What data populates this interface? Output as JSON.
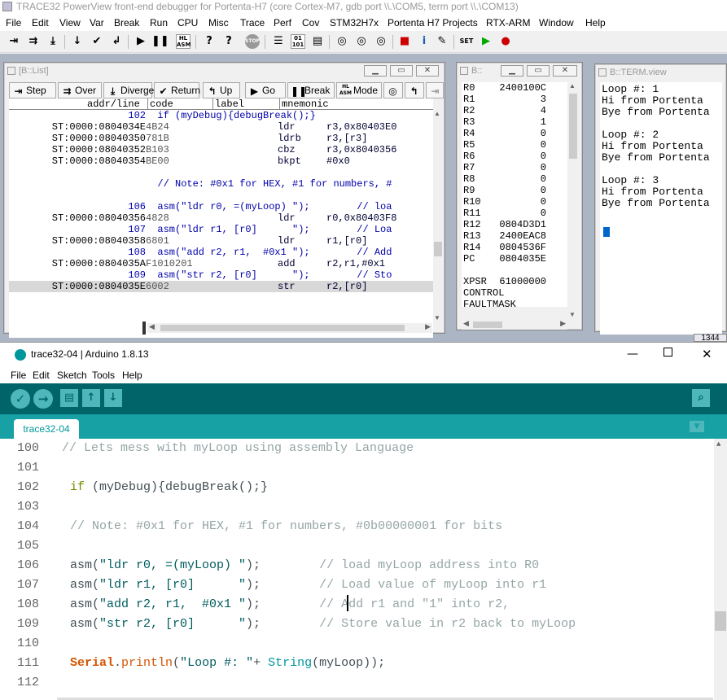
{
  "trace32": {
    "title": "TRACE32 PowerView front-end debugger for Portenta-H7 (core Cortex-M7, gdb port \\\\.\\COM5, term port \\\\.\\COM13)",
    "menu": [
      "File",
      "Edit",
      "View",
      "Var",
      "Break",
      "Run",
      "CPU",
      "Misc",
      "Trace",
      "Perf",
      "Cov",
      "STM32H7x",
      "Portenta H7 Projects",
      "RTX-ARM",
      "Window",
      "Help"
    ],
    "toolbar_icons": [
      "step-into-icon",
      "step-over-icon",
      "step-diverge-icon",
      "down-arrow-icon",
      "check-icon",
      "return-icon",
      "go-icon",
      "break-icon",
      "mode-icon",
      "help-icon",
      "context-help-icon",
      "stop-icon",
      "list-icon",
      "memory-icon",
      "registers-icon",
      "breakpoints-icon",
      "watch-icon",
      "var-icon",
      "cube-icon",
      "info-icon",
      "tools-icon",
      "set-icon",
      "go-green-icon",
      "stop-red-icon"
    ],
    "list_window": {
      "title": "[B::List]",
      "buttons": {
        "step": "Step",
        "over": "Over",
        "diverge": "Diverge",
        "return": "Return",
        "up": "Up",
        "go": "Go",
        "break": "Break",
        "mode": "Mode"
      },
      "headers": {
        "addr": "addr/line",
        "code": "code",
        "label": "label",
        "mnemonic": "mnemonic"
      },
      "rows": [
        {
          "type": "src",
          "line": "102",
          "text": "  if (myDebug){debugBreak();}"
        },
        {
          "type": "asm",
          "addr": "ST:0000:0804034E",
          "code": "4B24",
          "mnem": "ldr",
          "opnd": "r3,0x80403E0"
        },
        {
          "type": "asm",
          "addr": "ST:0000:08040350",
          "code": "781B",
          "mnem": "ldrb",
          "opnd": "r3,[r3]"
        },
        {
          "type": "asm",
          "addr": "ST:0000:08040352",
          "code": "B103",
          "mnem": "cbz",
          "opnd": "r3,0x8040356"
        },
        {
          "type": "asm",
          "addr": "ST:0000:08040354",
          "code": "BE00",
          "mnem": "bkpt",
          "opnd": "#0x0"
        },
        {
          "type": "blank"
        },
        {
          "type": "src",
          "line": "",
          "text": "  // Note: #0x1 for HEX, #1 for numbers, #"
        },
        {
          "type": "blank"
        },
        {
          "type": "src",
          "line": "106",
          "text": "  asm(\"ldr r0, =(myLoop) \");        // loa"
        },
        {
          "type": "asm",
          "addr": "ST:0000:08040356",
          "code": "4828",
          "mnem": "ldr",
          "opnd": "r0,0x80403F8"
        },
        {
          "type": "src",
          "line": "107",
          "text": "  asm(\"ldr r1, [r0]      \");        // Loa"
        },
        {
          "type": "asm",
          "addr": "ST:0000:08040358",
          "code": "6801",
          "mnem": "ldr",
          "opnd": "r1,[r0]"
        },
        {
          "type": "src",
          "line": "108",
          "text": "  asm(\"add r2, r1,  #0x1 \");        // Add"
        },
        {
          "type": "asm",
          "addr": "ST:0000:0804035A",
          "code": "F1010201",
          "mnem": "add",
          "opnd": "r2,r1,#0x1"
        },
        {
          "type": "src",
          "line": "109",
          "text": "  asm(\"str r2, [r0]      \");        // Sto"
        },
        {
          "type": "asm",
          "addr": "ST:0000:0804035E",
          "code": "6002",
          "mnem": "str",
          "opnd": "r2,[r0]",
          "selected": true
        }
      ]
    },
    "register_window": {
      "title": "B::",
      "registers": [
        {
          "name": "R0",
          "value": "2400100C"
        },
        {
          "name": "R1",
          "value": "3"
        },
        {
          "name": "R2",
          "value": "4"
        },
        {
          "name": "R3",
          "value": "1"
        },
        {
          "name": "R4",
          "value": "0"
        },
        {
          "name": "R5",
          "value": "0"
        },
        {
          "name": "R6",
          "value": "0"
        },
        {
          "name": "R7",
          "value": "0"
        },
        {
          "name": "R8",
          "value": "0"
        },
        {
          "name": "R9",
          "value": "0"
        },
        {
          "name": "R10",
          "value": "0"
        },
        {
          "name": "R11",
          "value": "0"
        },
        {
          "name": "R12",
          "value": "0804D3D1"
        },
        {
          "name": "R13",
          "value": "2400EAC8"
        },
        {
          "name": "R14",
          "value": "0804536F"
        },
        {
          "name": "PC",
          "value": "0804035E"
        },
        {
          "name": "",
          "value": ""
        },
        {
          "name": "XPSR",
          "value": "61000000"
        },
        {
          "name": "CONTROL",
          "value": ""
        },
        {
          "name": "FAULTMASK",
          "value": ""
        }
      ]
    },
    "term_window": {
      "title": "B::TERM.view",
      "lines": [
        "Loop #: 1",
        "Hi from Portenta",
        "Bye from Portenta",
        "",
        "Loop #: 2",
        "Hi from Portenta",
        "Bye from Portenta",
        "",
        "Loop #: 3",
        "Hi from Portenta",
        "Bye from Portenta"
      ]
    },
    "corner_badge": "1344"
  },
  "arduino": {
    "title": "trace32-04 | Arduino 1.8.13",
    "menu": [
      "File",
      "Edit",
      "Sketch",
      "Tools",
      "Help"
    ],
    "tab": "trace32-04",
    "lines": [
      {
        "n": "100",
        "html": "<span class=\"cm\">// Lets mess with myLoop using assembly Language</span>",
        "indent": 0
      },
      {
        "n": "101",
        "html": "",
        "indent": 0
      },
      {
        "n": "102",
        "html": "<span class=\"kw\">if</span> (myDebug){debugBreak();}",
        "indent": 1
      },
      {
        "n": "103",
        "html": "",
        "indent": 0
      },
      {
        "n": "104",
        "html": "<span class=\"cm\">// Note: #0x1 for HEX, #1 for numbers, #0b00000001 for bits</span>",
        "indent": 1
      },
      {
        "n": "105",
        "html": "",
        "indent": 0
      },
      {
        "n": "106",
        "html": "asm(<span class=\"st\">\"ldr r0, =(myLoop) \"</span>);        <span class=\"cm\">// load myLoop address into R0</span>",
        "indent": 1
      },
      {
        "n": "107",
        "html": "asm(<span class=\"st\">\"ldr r1, [r0]      \"</span>);        <span class=\"cm\">// Load value of myLoop into r1</span>",
        "indent": 1
      },
      {
        "n": "108",
        "html": "asm(<span class=\"st\">\"add r2, r1,  #0x1 \"</span>);        <span class=\"cm\">// Add r1 and \"1\" into r2,</span>",
        "indent": 1
      },
      {
        "n": "109",
        "html": "asm(<span class=\"st\">\"str r2, [r0]      \"</span>);        <span class=\"cm\">// Store value in r2 back to myLoop</span>",
        "indent": 1
      },
      {
        "n": "110",
        "html": "",
        "indent": 0
      },
      {
        "n": "111",
        "html": "<span class=\"fn\" style=\"font-weight:bold\">Serial</span>.<span class=\"fn\">println</span>(<span class=\"st\">\"Loop #: \"</span>+ <span class=\"cls\">String</span>(myLoop));",
        "indent": 1
      },
      {
        "n": "112",
        "html": "",
        "indent": 0
      }
    ]
  }
}
